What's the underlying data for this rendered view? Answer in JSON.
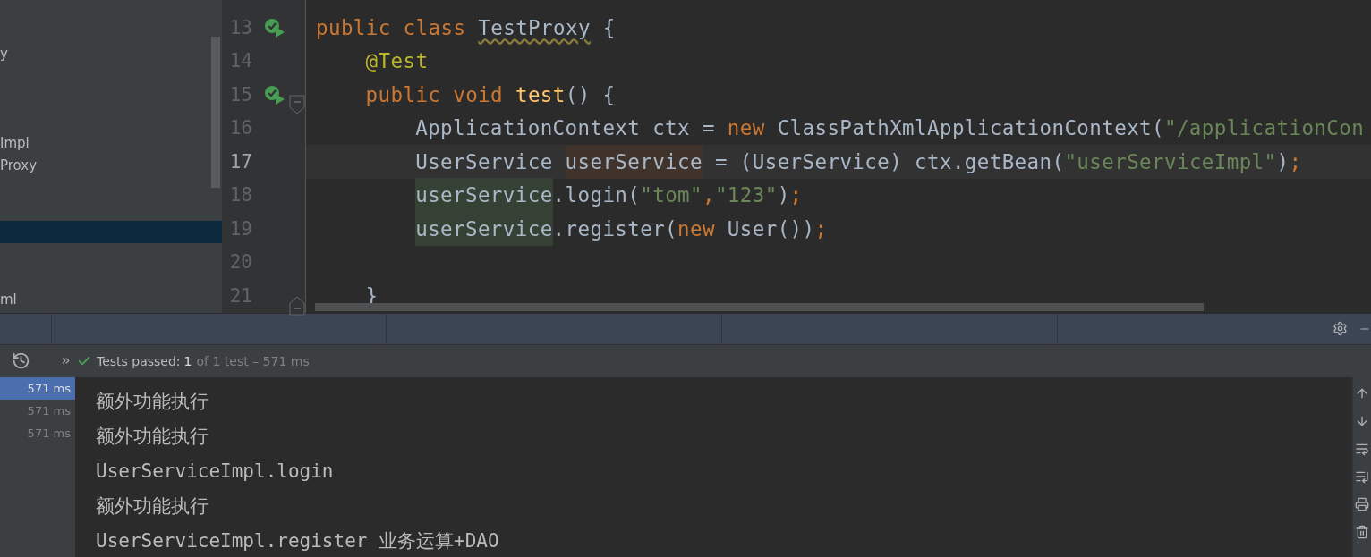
{
  "project_tree": {
    "items": [
      {
        "selected": false
      },
      {
        "text": "y",
        "selected": false
      },
      {
        "selected": false
      },
      {
        "selected": false
      },
      {
        "selected": false
      },
      {
        "text": "Impl",
        "selected": false
      },
      {
        "text": "Proxy",
        "selected": false
      },
      {
        "selected": false
      },
      {
        "selected": false
      },
      {
        "selected": true
      },
      {
        "selected": false
      },
      {
        "selected": false
      },
      {
        "text": "ml",
        "selected": false
      }
    ]
  },
  "editor": {
    "lines": [
      {
        "number": "13",
        "current": false,
        "run_marker": true,
        "tokens": [
          {
            "kind": "kw",
            "text": "public class "
          },
          {
            "kind": "warn",
            "text": "TestProxy"
          },
          {
            "kind": "plain",
            "text": " {"
          }
        ],
        "children": [
          {
            "number": "14",
            "current": false,
            "run_marker": false,
            "tokens": [
              {
                "kind": "ann",
                "text": "@Test"
              }
            ]
          },
          {
            "number": "15",
            "current": false,
            "run_marker": true,
            "kind": "block_start",
            "tokens": [
              {
                "kind": "kw",
                "text": "public void "
              },
              {
                "kind": "fn",
                "text": "test"
              },
              {
                "kind": "plain",
                "text": "() {"
              }
            ],
            "children": [
              {
                "number": "16",
                "current": false,
                "run_marker": false,
                "tokens": [
                  {
                    "kind": "plain",
                    "text": "ApplicationContext ctx = "
                  },
                  {
                    "kind": "kw",
                    "text": "new"
                  },
                  {
                    "kind": "plain",
                    "text": " ClassPathXmlApplicationContext("
                  },
                  {
                    "kind": "str",
                    "text": "\"/applicationCon"
                  }
                ]
              },
              {
                "number": "17",
                "current": true,
                "run_marker": false,
                "tokens": [
                  {
                    "kind": "plain",
                    "text": "UserService "
                  },
                  {
                    "kind": "var_write",
                    "text": "userService"
                  },
                  {
                    "kind": "plain",
                    "text": " = (UserService) ctx.getBean("
                  },
                  {
                    "kind": "str",
                    "text": "\"userServiceImpl\""
                  },
                  {
                    "kind": "plain",
                    "text": ")"
                  },
                  {
                    "kind": "kw",
                    "text": ";"
                  }
                ]
              },
              {
                "number": "18",
                "current": false,
                "run_marker": false,
                "tokens": [
                  {
                    "kind": "var_read",
                    "text": "userService"
                  },
                  {
                    "kind": "plain",
                    "text": ".login("
                  },
                  {
                    "kind": "str",
                    "text": "\"tom\""
                  },
                  {
                    "kind": "kw",
                    "text": ","
                  },
                  {
                    "kind": "str",
                    "text": "\"123\""
                  },
                  {
                    "kind": "plain",
                    "text": ")"
                  },
                  {
                    "kind": "kw",
                    "text": ";"
                  }
                ]
              },
              {
                "number": "19",
                "current": false,
                "run_marker": false,
                "tokens": [
                  {
                    "kind": "var_read",
                    "text": "userService"
                  },
                  {
                    "kind": "plain",
                    "text": ".register("
                  },
                  {
                    "kind": "kw",
                    "text": "new"
                  },
                  {
                    "kind": "plain",
                    "text": " User())"
                  },
                  {
                    "kind": "kw",
                    "text": ";"
                  }
                ]
              },
              {
                "number": "20",
                "current": false,
                "run_marker": false
              }
            ]
          },
          {
            "number": "21",
            "current": false,
            "run_marker": false,
            "kind": "block_end",
            "tokens": [
              {
                "kind": "plain",
                "text": "}"
              }
            ]
          }
        ]
      }
    ]
  },
  "run_panel": {
    "status": "Tests passed:",
    "passed_count": "1",
    "detail": "of 1 test – 571 ms",
    "tests": [
      {
        "time": "571 ms",
        "selected": true
      },
      {
        "time": "571 ms",
        "selected": false
      },
      {
        "time": "571 ms",
        "selected": false
      }
    ],
    "console": [
      "额外功能执行",
      "额外功能执行",
      "UserServiceImpl.login",
      "额外功能执行",
      "UserServiceImpl.register 业务运算+DAO"
    ]
  }
}
